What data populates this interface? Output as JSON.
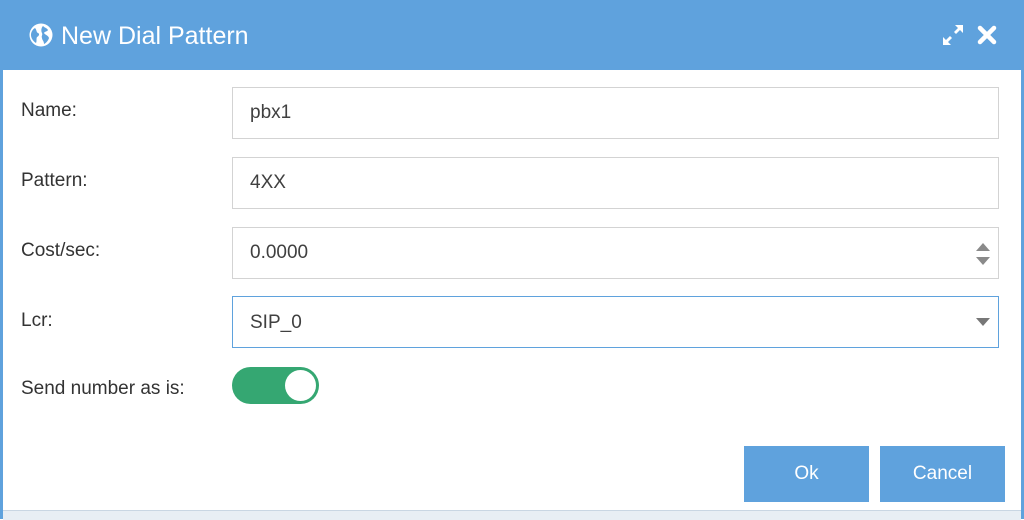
{
  "dialog": {
    "title": "New Dial Pattern",
    "icons": {
      "title": "globe-icon",
      "maximize": "maximize-icon",
      "close": "close-icon"
    }
  },
  "form": {
    "name": {
      "label": "Name:",
      "value": "pbx1"
    },
    "pattern": {
      "label": "Pattern:",
      "value": "4XX"
    },
    "cost": {
      "label": "Cost/sec:",
      "value": "0.0000"
    },
    "lcr": {
      "label": "Lcr:",
      "value": "SIP_0"
    },
    "send_as_is": {
      "label": "Send number as is:",
      "checked": true
    }
  },
  "buttons": {
    "ok": "Ok",
    "cancel": "Cancel"
  },
  "colors": {
    "accent": "#5fa2dd",
    "toggle_on": "#35a772"
  }
}
